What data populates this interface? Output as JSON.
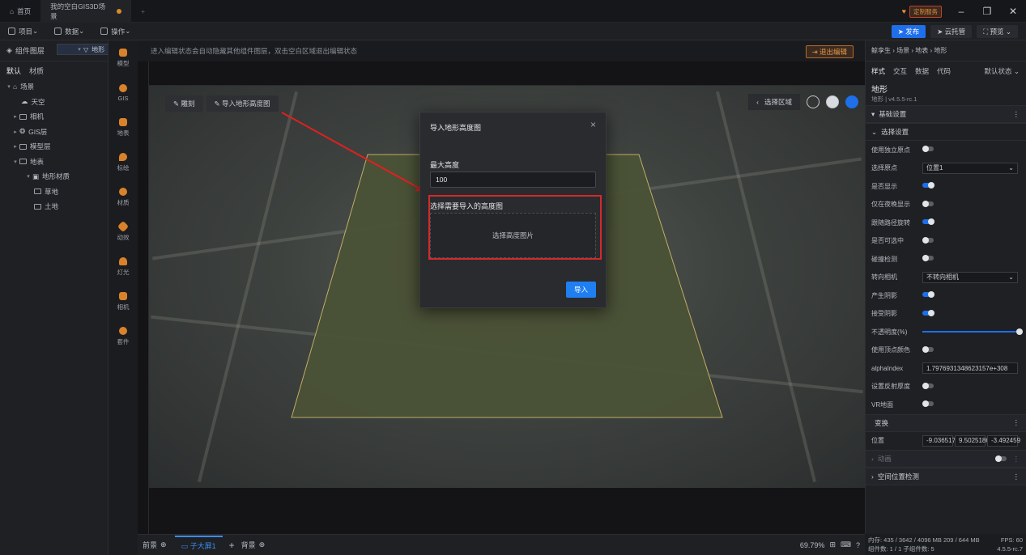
{
  "tabs": {
    "home": "首页",
    "current": "我的空白GIS3D场景"
  },
  "window": {
    "badge": "定制服务"
  },
  "toolbar": {
    "project": "项目",
    "data": "数据",
    "ops": "操作",
    "publish": "发布",
    "cloud": "云托管",
    "preview": "预览"
  },
  "leftpanel": {
    "title": "组件图层",
    "tabs": [
      "默认",
      "材质"
    ],
    "tree": [
      "场景",
      "天空",
      "相机",
      "GIS层",
      "模型层",
      "地表",
      "地形",
      "地形材质",
      "草地",
      "土地"
    ]
  },
  "iconcol": [
    "模型",
    "GIS",
    "地表",
    "标绘",
    "材质",
    "动效",
    "灯光",
    "相机",
    "套件"
  ],
  "canvas": {
    "hint": "进入编辑状态会自动隐藏其他组件图层，双击空白区域退出编辑状态",
    "exit": "退出编辑",
    "tools": {
      "sculpt": "雕刻",
      "import": "导入地形高度图"
    },
    "select_area": "选择区域"
  },
  "modal": {
    "title": "导入地形高度图",
    "max_height_label": "最大高度",
    "max_height_value": "100",
    "select_label": "选择需要导入的高度图",
    "select_placeholder": "选择高度图片",
    "import_button": "导入"
  },
  "bottom": {
    "front": "前景",
    "sub": "子大屏1",
    "bg": "背景",
    "zoom": "69.79%"
  },
  "rightpanel": {
    "breadcrumb": "鲸孪生 › 场景 › 地表 › 地形",
    "tabs": [
      "样式",
      "交互",
      "数据",
      "代码"
    ],
    "state": "默认状态",
    "title": "地形",
    "subtitle": "地形 | v4.5.5-rc.1",
    "section_basic": "基础设置",
    "section_select": "选择设置",
    "props": [
      {
        "label": "使用独立原点",
        "type": "toggle",
        "on": false
      },
      {
        "label": "选择原点",
        "type": "select",
        "value": "位置1"
      },
      {
        "label": "是否显示",
        "type": "toggle",
        "on": true
      },
      {
        "label": "仅在夜晚显示",
        "type": "toggle",
        "on": false
      },
      {
        "label": "跟随路径旋转",
        "type": "toggle",
        "on": true
      },
      {
        "label": "是否可选中",
        "type": "toggle",
        "on": false
      },
      {
        "label": "碰撞检测",
        "type": "toggle",
        "on": false
      },
      {
        "label": "转向相机",
        "type": "select",
        "value": "不转向相机"
      },
      {
        "label": "产生阴影",
        "type": "toggle",
        "on": true
      },
      {
        "label": "接受阴影",
        "type": "toggle",
        "on": true
      },
      {
        "label": "不透明度(%)",
        "type": "slider",
        "value": 100
      },
      {
        "label": "使用顶点颜色",
        "type": "toggle",
        "on": false
      },
      {
        "label": "alphaIndex",
        "type": "input",
        "value": "1.7976931348623157e+308"
      },
      {
        "label": "设置反射厚度",
        "type": "toggle",
        "on": false
      },
      {
        "label": "VR地面",
        "type": "toggle",
        "on": false
      }
    ],
    "section_transform": "变换",
    "position_label": "位置",
    "position": [
      "-9.036517",
      "9.5025186",
      "-3.492459"
    ],
    "section_anim": "动画",
    "section_space": "空间位置检测"
  },
  "status": {
    "mem": "内存: 435 / 3642 / 4096 MB  209 / 644 MB",
    "fps": "FPS: 60",
    "count": "组件数: 1 / 1  子组件数: 5",
    "ver": "4.5.5-rc.7"
  }
}
